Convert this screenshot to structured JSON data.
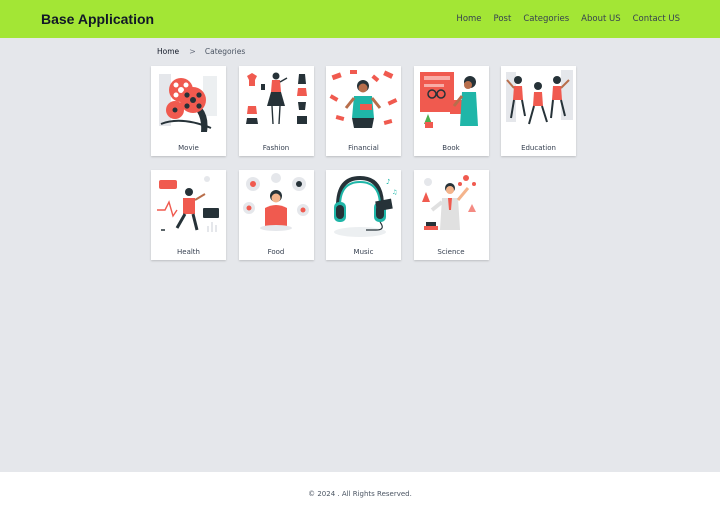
{
  "navbar": {
    "brand": "Base Application",
    "links": [
      {
        "label": "Home"
      },
      {
        "label": "Post"
      },
      {
        "label": "Categories"
      },
      {
        "label": "About US"
      },
      {
        "label": "Contact US"
      }
    ],
    "background": "#a3e635"
  },
  "breadcrumb": {
    "home": "Home",
    "separator": ">",
    "current": "Categories"
  },
  "categories": [
    {
      "label": "Movie",
      "icon": "film-reel-illustration"
    },
    {
      "label": "Fashion",
      "icon": "fashion-illustration"
    },
    {
      "label": "Financial",
      "icon": "finance-illustration"
    },
    {
      "label": "Book",
      "icon": "book-illustration"
    },
    {
      "label": "Education",
      "icon": "education-illustration"
    },
    {
      "label": "Health",
      "icon": "health-illustration"
    },
    {
      "label": "Food",
      "icon": "food-illustration"
    },
    {
      "label": "Music",
      "icon": "headphones-illustration"
    },
    {
      "label": "Science",
      "icon": "science-illustration"
    }
  ],
  "footer": {
    "text": "© 2024 . All Rights Reserved."
  },
  "colors": {
    "accent": "#f05a4f",
    "dark": "#263238",
    "teal": "#1fb6a8",
    "page_bg": "#e5e7eb"
  }
}
